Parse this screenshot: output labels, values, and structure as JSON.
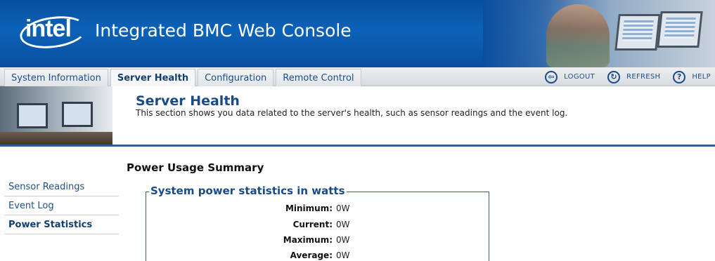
{
  "header": {
    "logo_text": "intel",
    "app_title": "Integrated BMC Web Console"
  },
  "nav": {
    "tabs": [
      {
        "label": "System Information"
      },
      {
        "label": "Server Health"
      },
      {
        "label": "Configuration"
      },
      {
        "label": "Remote Control"
      }
    ],
    "active_tab": "Server Health",
    "tools": {
      "logout": "LOGOUT",
      "refresh": "REFRESH",
      "help": "HELP"
    }
  },
  "section": {
    "title": "Server Health",
    "description": "This section shows you data related to the server's health, such as sensor readings and the event log."
  },
  "sidebar": {
    "items": [
      {
        "label": "Sensor Readings"
      },
      {
        "label": "Event Log"
      },
      {
        "label": "Power Statistics"
      }
    ],
    "active_item": "Power Statistics"
  },
  "main": {
    "page_title": "Power Usage Summary",
    "group_title": "System power statistics in watts",
    "stats": [
      {
        "label": "Minimum:",
        "value": "0W"
      },
      {
        "label": "Current:",
        "value": "0W"
      },
      {
        "label": "Maximum:",
        "value": "0W"
      },
      {
        "label": "Average:",
        "value": "0W"
      }
    ]
  },
  "colors": {
    "brand_blue": "#0a4f9e",
    "link_blue": "#1d4f8a",
    "rule_blue": "#2c5f96"
  },
  "icons": {
    "logout": "logout-icon",
    "refresh": "refresh-icon",
    "help": "help-icon"
  }
}
